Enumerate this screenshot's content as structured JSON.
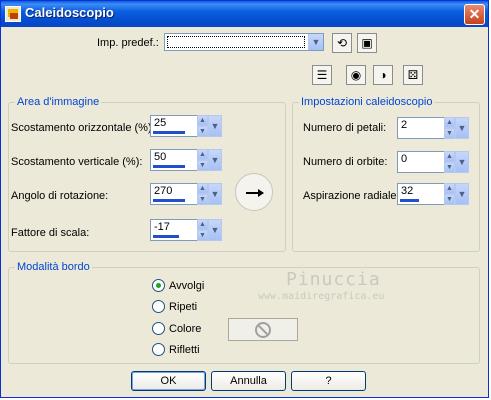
{
  "window": {
    "title": "Caleidoscopio",
    "close_glyph": "✕"
  },
  "preset": {
    "label": "Imp. predef.:",
    "value": ""
  },
  "toolbar_icons": [
    "reset-icon",
    "save-icon",
    "dialog-settings-icon",
    "proof-preview-icon",
    "auto-preview-icon",
    "randomize-icon"
  ],
  "image_area": {
    "title": "Area d'immagine",
    "fields": [
      {
        "label": "Scostamento orizzontale (%):",
        "value": "25",
        "fill": 0.75
      },
      {
        "label": "Scostamento verticale (%):",
        "value": "50",
        "fill": 0.75
      },
      {
        "label": "Angolo di rotazione:",
        "value": "270",
        "fill": 0.75
      },
      {
        "label": "Fattore di scala:",
        "value": "-17",
        "fill": 0.62
      }
    ]
  },
  "kaleido_settings": {
    "title": "Impostazioni caleidoscopio",
    "fields": [
      {
        "label": "Numero di petali:",
        "value": "2",
        "fill": 0.0
      },
      {
        "label": "Numero di orbite:",
        "value": "0",
        "fill": 0.0
      },
      {
        "label": "Aspirazione radiale:",
        "value": "32",
        "fill": 0.45
      }
    ]
  },
  "edge_mode": {
    "title": "Modalità bordo",
    "options": [
      {
        "label": "Avvolgi",
        "selected": true
      },
      {
        "label": "Ripeti",
        "selected": false
      },
      {
        "label": "Colore",
        "selected": false
      },
      {
        "label": "Rifletti",
        "selected": false
      }
    ]
  },
  "watermark": {
    "line1": "Pinuccia",
    "line2": "www.maidiregrafica.eu"
  },
  "buttons": {
    "ok": "OK",
    "cancel": "Annulla",
    "help": "?"
  }
}
